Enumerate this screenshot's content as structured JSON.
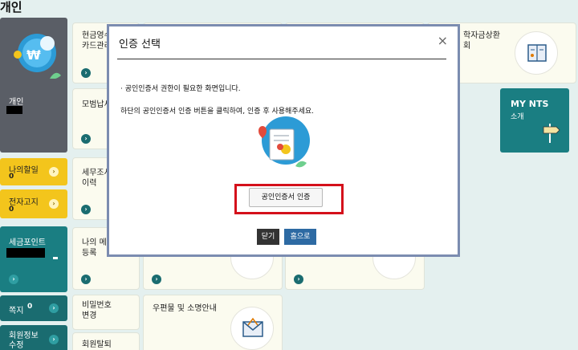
{
  "page": {
    "title": "개인"
  },
  "profile": {
    "label": "개인"
  },
  "tiles": {
    "cash_receipt": "현금영수\n카드관리",
    "model_tax": "모범납세",
    "tax_history": "세무조사\n이력",
    "my_info": "나의 메\n등록",
    "password": "비밀번호\n변경",
    "withdraw": "회원탈퇴",
    "postal": "우편물 및 소명안내",
    "student_loan": "학자금상환\n회"
  },
  "my_nts": {
    "title": "MY NTS",
    "subtitle": "소개"
  },
  "sidebar": [
    {
      "label": "나의할일",
      "count": "0"
    },
    {
      "label": "전자고지",
      "count": "0"
    },
    {
      "label": "세금포인트"
    },
    {
      "label": "쪽지",
      "count": "0"
    },
    {
      "label": "회원정보\n수정"
    }
  ],
  "modal": {
    "title": "인증 선택",
    "close_symbol": "×",
    "notice_line1": "· 공인인증서 권한이 필요한 화면입니다.",
    "notice_line2": "하단의 공인인증서 인증 버튼을 클릭하여, 인증 후 사용해주세요.",
    "cert_button": "공인인증서 인증",
    "close_button": "닫기",
    "home_button": "홈으로"
  },
  "colors": {
    "teal": "#1a7e82",
    "yellow": "#f3c51c",
    "highlight_red": "#d4101b",
    "home_blue": "#2d6aa3"
  },
  "icons": [
    "won-globe-icon",
    "certificate-icon",
    "book-icon",
    "signpost-icon",
    "mail-icon",
    "arrow-right-icon"
  ]
}
